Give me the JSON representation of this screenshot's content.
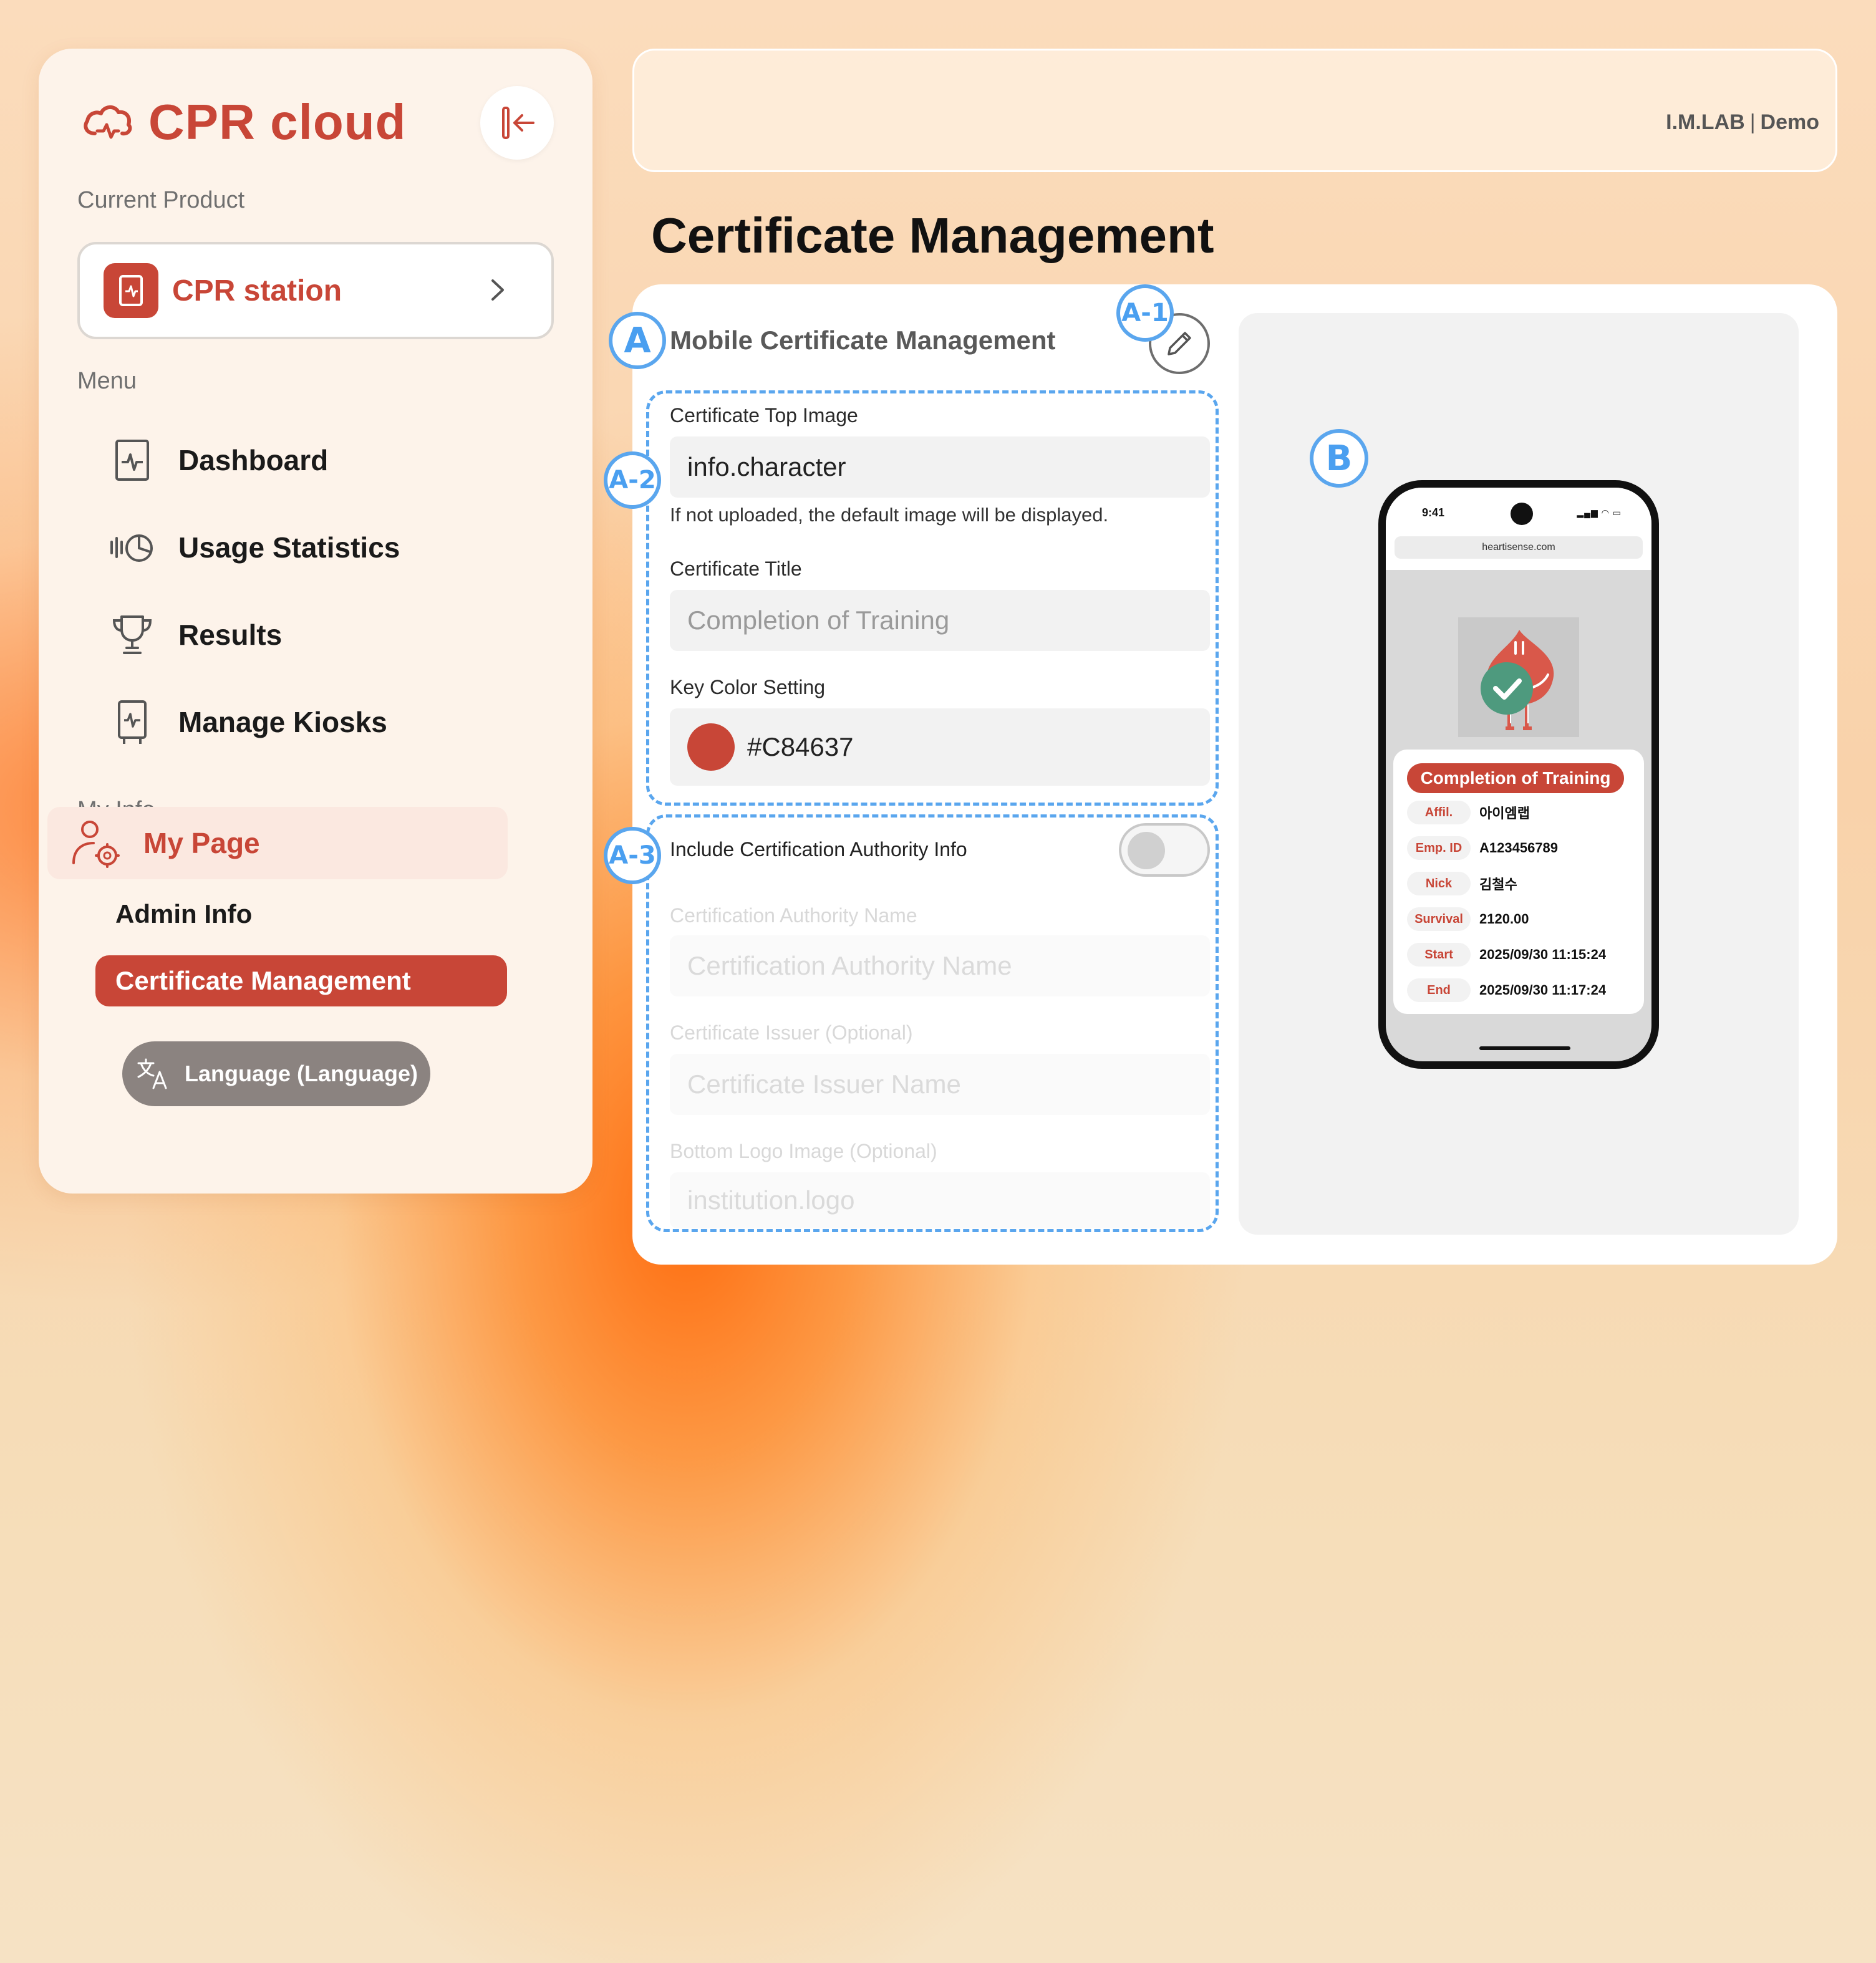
{
  "sidebar": {
    "brand": "CPR cloud",
    "current_product_label": "Current Product",
    "product_name": "CPR station",
    "menu_label": "Menu",
    "menu": [
      {
        "label": "Dashboard",
        "icon": "dashboard-icon"
      },
      {
        "label": "Usage Statistics",
        "icon": "usage-statistics-icon"
      },
      {
        "label": "Results",
        "icon": "trophy-icon"
      },
      {
        "label": "Manage Kiosks",
        "icon": "kiosk-icon"
      }
    ],
    "myinfo_label": "My Info",
    "mypage_label": "My Page",
    "admin_info_label": "Admin Info",
    "cert_mgmt_label": "Certificate Management",
    "language_label": "Language (Language)"
  },
  "topbar": {
    "org": "I.M.LAB",
    "separator": "|",
    "user": "Demo"
  },
  "page_title": "Certificate Management",
  "form": {
    "title": "Mobile Certificate Management",
    "top_image_label": "Certificate Top Image",
    "top_image_value": "info.character",
    "top_image_hint": "If not uploaded, the default image will be displayed.",
    "cert_title_label": "Certificate Title",
    "cert_title_placeholder": "Completion of Training",
    "key_color_label": "Key Color Setting",
    "key_color_value": "#C84637",
    "include_authority_label": "Include Certification Authority Info",
    "include_authority_enabled": false,
    "authority_name_label": "Certification Authority Name",
    "authority_name_placeholder": "Certification Authority Name",
    "issuer_label": "Certificate Issuer (Optional)",
    "issuer_placeholder": "Certificate Issuer Name",
    "logo_label": "Bottom Logo Image (Optional)",
    "logo_value": "institution.logo"
  },
  "markers": {
    "a": "A",
    "a1": "A-1",
    "a2": "A-2",
    "a3": "A-3",
    "b": "B"
  },
  "preview": {
    "time": "9:41",
    "url": "heartisense.com",
    "cert_title": "Completion of Training",
    "rows": [
      {
        "key": "Affil.",
        "value": "아이엠랩"
      },
      {
        "key": "Emp. ID",
        "value": "A123456789"
      },
      {
        "key": "Nick",
        "value": "김철수"
      },
      {
        "key": "Survival",
        "value": "2120.00"
      },
      {
        "key": "Start",
        "value": "2025/09/30 11:15:24"
      },
      {
        "key": "End",
        "value": "2025/09/30 11:17:24"
      }
    ]
  },
  "colors": {
    "accent": "#C84637",
    "marker": "#5AA6EE"
  }
}
